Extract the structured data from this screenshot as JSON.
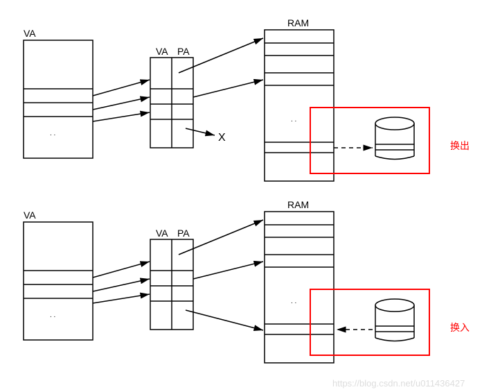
{
  "top": {
    "va_label": "VA",
    "table_va": "VA",
    "table_pa": "PA",
    "ram_label": "RAM",
    "x_label": "X",
    "red_label": "换出"
  },
  "bottom": {
    "va_label": "VA",
    "table_va": "VA",
    "table_pa": "PA",
    "ram_label": "RAM",
    "red_label": "换入"
  },
  "watermark": "https://blog.csdn.net/u011436427"
}
